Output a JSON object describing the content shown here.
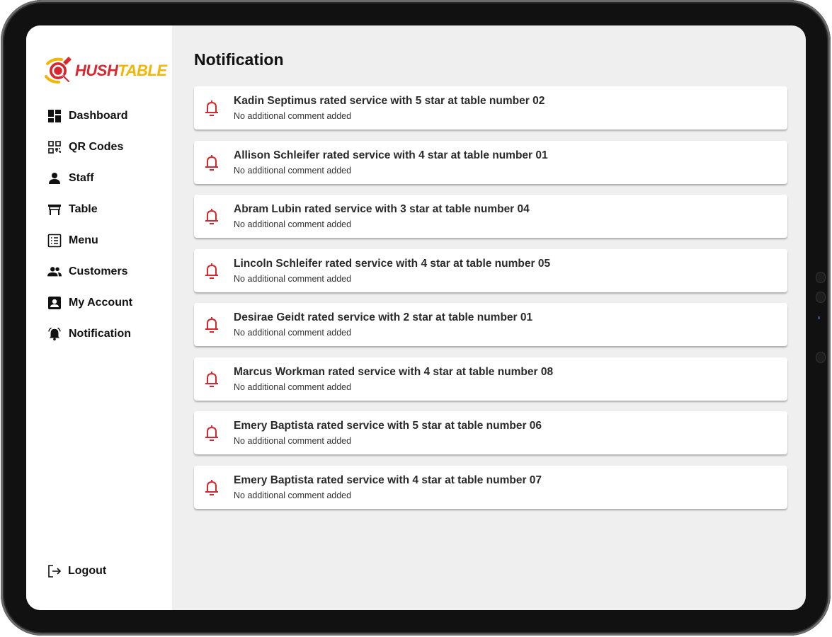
{
  "brand": {
    "name_part1": "HUSH",
    "name_part2": "TABLE",
    "colors": {
      "red": "#d7282f",
      "yellow": "#f2b705"
    }
  },
  "sidebar": {
    "items": [
      {
        "label": "Dashboard",
        "icon": "dashboard-icon"
      },
      {
        "label": "QR Codes",
        "icon": "qr-code-icon"
      },
      {
        "label": "Staff",
        "icon": "person-icon"
      },
      {
        "label": "Table",
        "icon": "table-icon"
      },
      {
        "label": "Menu",
        "icon": "menu-list-icon"
      },
      {
        "label": "Customers",
        "icon": "people-icon"
      },
      {
        "label": "My Account",
        "icon": "account-box-icon"
      },
      {
        "label": "Notification",
        "icon": "alarm-bell-icon"
      }
    ],
    "logout": {
      "label": "Logout",
      "icon": "logout-icon"
    }
  },
  "main": {
    "title": "Notification",
    "notifications": [
      {
        "title": "Kadin Septimus rated service with 5 star at table number 02",
        "comment": "No additional comment added"
      },
      {
        "title": "Allison Schleifer rated service with 4 star at table number 01",
        "comment": "No additional comment added"
      },
      {
        "title": "Abram Lubin rated service with 3 star at table number 04",
        "comment": "No additional comment added"
      },
      {
        "title": "Lincoln Schleifer rated service with 4 star at table number 05",
        "comment": "No additional comment added"
      },
      {
        "title": "Desirae Geidt rated service with 2 star at table number 01",
        "comment": "No additional comment added"
      },
      {
        "title": "Marcus Workman rated service with 4 star at table number 08",
        "comment": "No additional comment added"
      },
      {
        "title": "Emery Baptista rated service with 5 star at table number 06",
        "comment": "No additional comment added"
      },
      {
        "title": "Emery Baptista rated service with 4 star at table number 07",
        "comment": "No additional comment added"
      }
    ],
    "bell_color": "#d7282f"
  }
}
